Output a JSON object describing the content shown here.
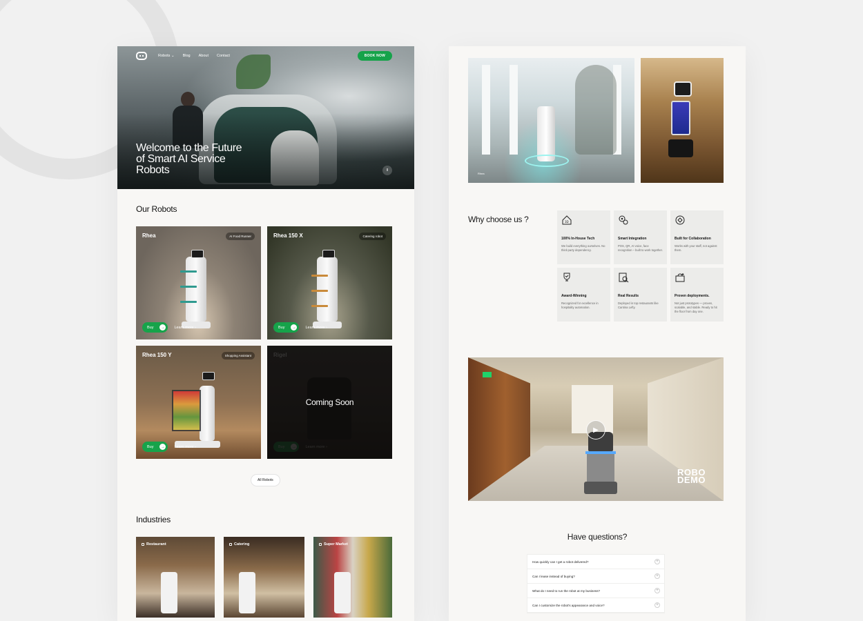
{
  "left_page": {
    "nav": {
      "links": [
        "Robots ⌄",
        "Blog",
        "About",
        "Contact"
      ],
      "book_label": "BOOK NOW"
    },
    "hero": {
      "title": "Welcome to the Future of Smart AI Service Robots",
      "pause_glyph": "II"
    },
    "robots_section": {
      "title": "Our Robots",
      "cards": [
        {
          "name": "Rhea",
          "tag": "AI Food Runner",
          "buy": "Buy",
          "learn": "Learn more ›"
        },
        {
          "name": "Rhea 150 X",
          "tag": "Catering robot",
          "buy": "Buy",
          "learn": "Learn more ›"
        },
        {
          "name": "Rhea 150 Y",
          "tag": "Shopping Assistant",
          "buy": "Buy",
          "learn": "Learn more ›"
        },
        {
          "name": "Rigel",
          "tag": "",
          "buy": "Buy",
          "learn": "Learn more ›",
          "overlay": "Coming Soon"
        }
      ],
      "all_label": "All Robots"
    },
    "industries_section": {
      "title": "Industries",
      "cards": [
        {
          "label": "Restaurant"
        },
        {
          "label": "Catering"
        },
        {
          "label": "Super Market"
        }
      ]
    }
  },
  "right_page": {
    "photo_caption": "Rhea",
    "why": {
      "title": "Why choose us ?",
      "features": [
        {
          "icon": "house-3d-icon",
          "title": "100% In-House Tech",
          "desc": "We build everything ourselves. No third-party dependency."
        },
        {
          "icon": "gears-icon",
          "title": "Smart Integration",
          "desc": "POS, QR, AI voice, face recognition – built to work together."
        },
        {
          "icon": "collaboration-icon",
          "title": "Built for Collaboration",
          "desc": "Works with your staff, not against them."
        },
        {
          "icon": "trophy-icon",
          "title": "Award-Winning",
          "desc": "Recognized for excellence in hospitality automation."
        },
        {
          "icon": "chart-search-icon",
          "title": "Real Results",
          "desc": "Deployed in top restaurants like Cantina Lefty."
        },
        {
          "icon": "deploy-icon",
          "title": "Proven deployments.",
          "desc": "Not just prototypes — proven, scalable, and stable. Ready to hit the floor from day one."
        }
      ]
    },
    "video": {
      "demo_line1": "ROBO",
      "demo_line2": "DEMO"
    },
    "faq": {
      "title": "Have questions?",
      "items": [
        "How quickly can I get a robot delivered?",
        "Can I lease instead of buying?",
        "What do I need to run the robot at my business?",
        "Can I customize the robot's appearance and voice?"
      ]
    }
  },
  "colors": {
    "accent": "#16a34a",
    "page_bg": "#f8f7f5",
    "canvas_bg": "#f1f1f1"
  }
}
